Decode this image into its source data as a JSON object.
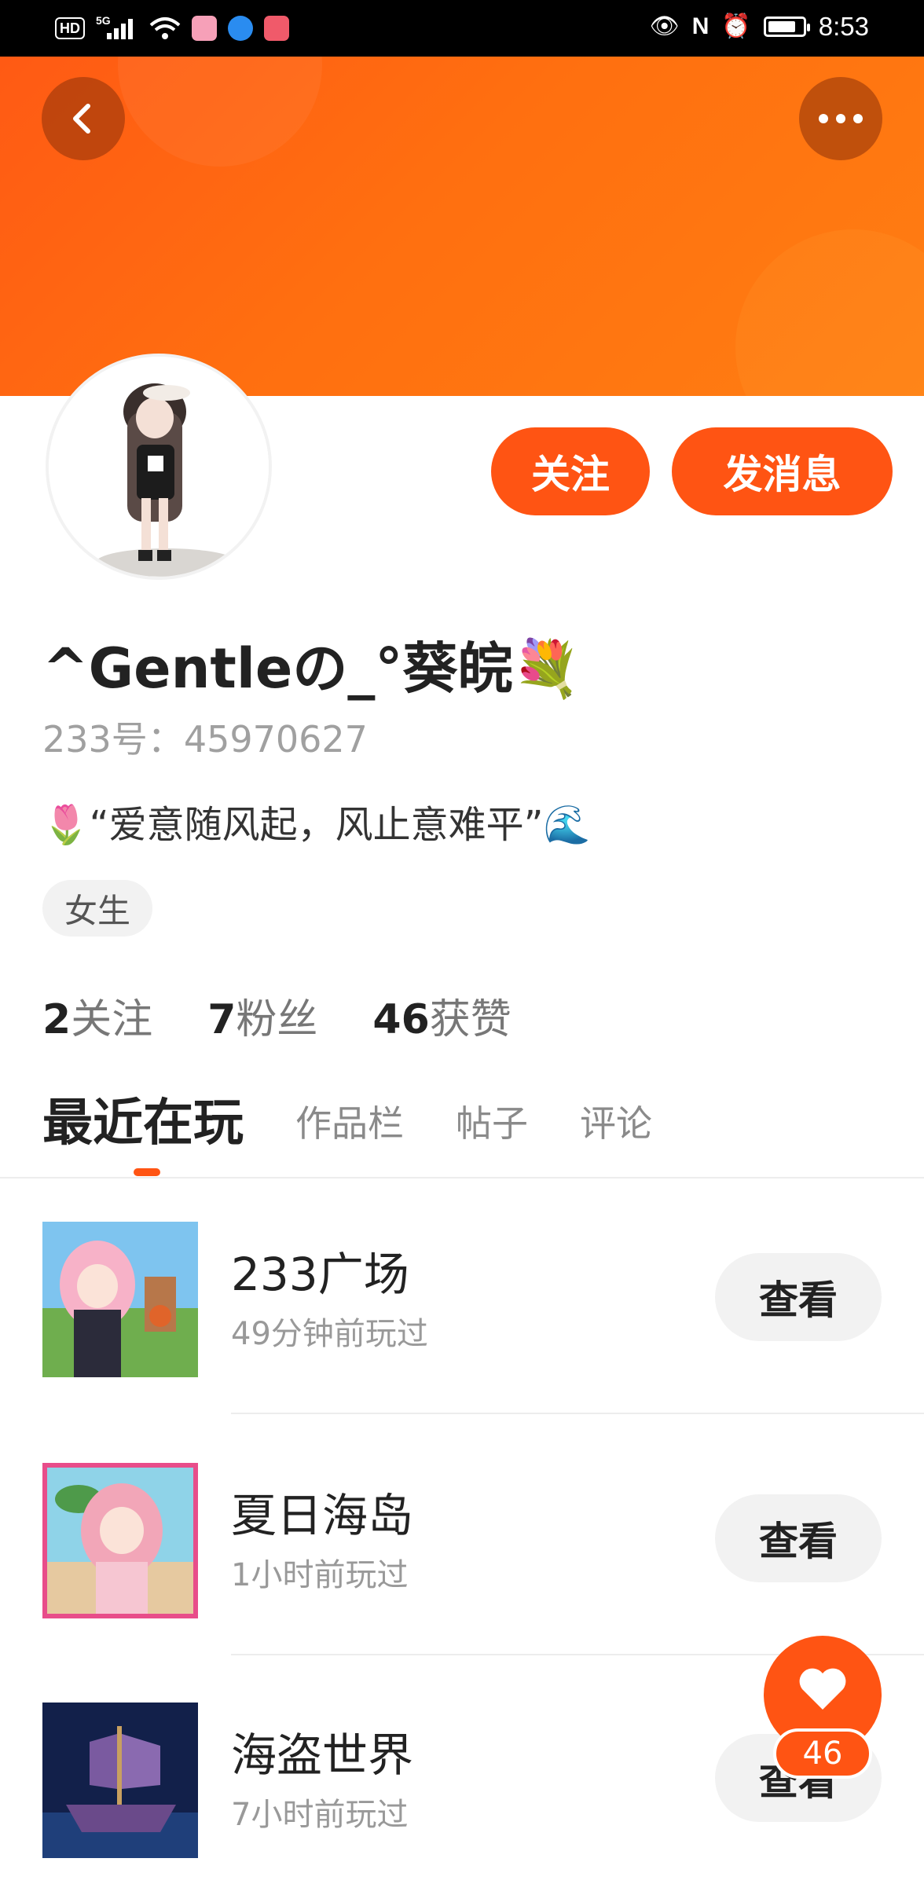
{
  "status_bar": {
    "hd": "HD",
    "network": "5G",
    "time": "8:53"
  },
  "profile": {
    "username": "^Gentleの_°葵皖💐",
    "id_label": "233号：",
    "id_value": "45970627",
    "bio": "🌷“爱意随风起，风止意难平”🌊",
    "gender": "女生",
    "follow_label": "关注",
    "message_label": "发消息"
  },
  "stats": {
    "following_count": "2",
    "following_label": "关注",
    "fans_count": "7",
    "fans_label": "粉丝",
    "likes_count": "46",
    "likes_label": "获赞"
  },
  "tabs": [
    {
      "label": "最近在玩",
      "active": true
    },
    {
      "label": "作品栏",
      "active": false
    },
    {
      "label": "帖子",
      "active": false
    },
    {
      "label": "评论",
      "active": false
    }
  ],
  "games": [
    {
      "title": "233广场",
      "time": "49分钟前玩过",
      "button": "查看"
    },
    {
      "title": "夏日海岛",
      "time": "1小时前玩过",
      "button": "查看"
    },
    {
      "title": "海盗世界",
      "time": "7小时前玩过",
      "button": "查看"
    }
  ],
  "like_fab": {
    "count": "46"
  },
  "icons": {
    "back": "back-arrow-icon",
    "more": "more-dots-icon",
    "like": "heart-icon"
  },
  "colors": {
    "accent": "#ff5413",
    "banner_start": "#ff5a14",
    "banner_end": "#ff7e12"
  }
}
